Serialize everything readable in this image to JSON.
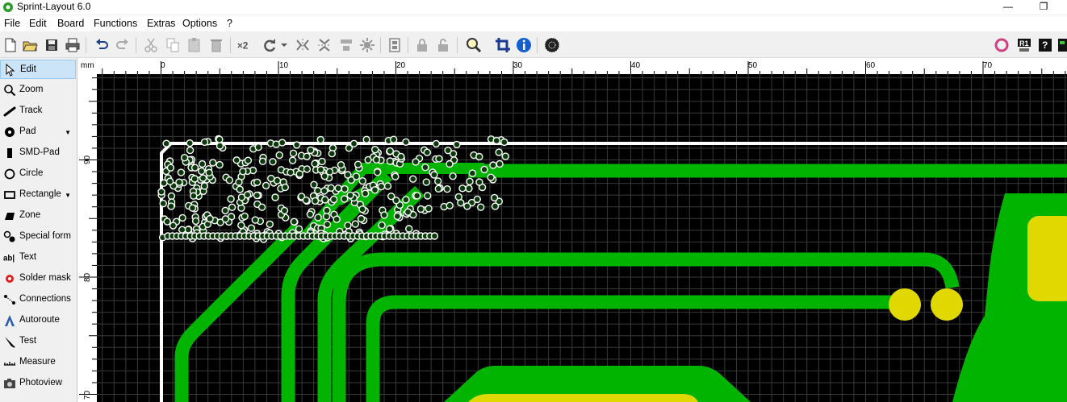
{
  "app": {
    "title": "Sprint-Layout 6.0"
  },
  "window_controls": {
    "minimize": "—",
    "restore": "❐"
  },
  "menu": [
    "File",
    "Edit",
    "Board",
    "Functions",
    "Extras",
    "Options",
    "?"
  ],
  "toolbar": {
    "left": [
      {
        "name": "new-icon"
      },
      {
        "name": "open-icon"
      },
      {
        "name": "save-icon"
      },
      {
        "name": "print-icon"
      },
      {
        "name": "undo-icon"
      },
      {
        "name": "redo-icon"
      },
      {
        "name": "cut-icon"
      },
      {
        "name": "copy-icon"
      },
      {
        "name": "paste-icon"
      },
      {
        "name": "delete-icon"
      },
      {
        "name": "duplicate-icon",
        "label": "×2"
      },
      {
        "name": "rotate-icon"
      },
      {
        "name": "mirror-horizontal-icon"
      },
      {
        "name": "mirror-vertical-icon"
      },
      {
        "name": "align-icon"
      },
      {
        "name": "snap-icon"
      },
      {
        "name": "group-icon"
      },
      {
        "name": "ungroup-icon"
      },
      {
        "name": "lock-icon"
      },
      {
        "name": "unlock-icon"
      },
      {
        "name": "zoom-icon"
      },
      {
        "name": "crop-icon"
      },
      {
        "name": "info-icon"
      },
      {
        "name": "gerber-icon"
      }
    ],
    "right": [
      {
        "name": "ring-icon"
      },
      {
        "name": "r1-icon",
        "label": "R1"
      },
      {
        "name": "help-chip-icon",
        "label": "?"
      },
      {
        "name": "chip-icon"
      }
    ]
  },
  "tools": [
    {
      "label": "Edit",
      "icon": "cursor-icon",
      "active": true
    },
    {
      "label": "Zoom",
      "icon": "magnifier-icon"
    },
    {
      "label": "Track",
      "icon": "track-icon"
    },
    {
      "label": "Pad",
      "icon": "pad-icon",
      "has_menu": true
    },
    {
      "label": "SMD-Pad",
      "icon": "smd-pad-icon"
    },
    {
      "label": "Circle",
      "icon": "circle-icon"
    },
    {
      "label": "Rectangle",
      "icon": "rectangle-icon",
      "has_menu": true
    },
    {
      "label": "Zone",
      "icon": "zone-icon"
    },
    {
      "label": "Special form",
      "icon": "special-form-icon"
    },
    {
      "label": "Text",
      "icon": "text-icon"
    },
    {
      "label": "Solder mask",
      "icon": "solder-mask-icon"
    },
    {
      "label": "Connections",
      "icon": "connections-icon"
    },
    {
      "label": "Autoroute",
      "icon": "autoroute-icon"
    },
    {
      "label": "Test",
      "icon": "test-icon"
    },
    {
      "label": "Measure",
      "icon": "measure-icon"
    },
    {
      "label": "Photoview",
      "icon": "photoview-icon"
    }
  ],
  "ruler": {
    "unit": "mm",
    "h_labels": [
      "0",
      "10",
      "20",
      "30",
      "40",
      "50",
      "60",
      "70"
    ],
    "v_labels": [
      "90",
      "80",
      "70"
    ]
  },
  "colors": {
    "copper": "#00b400",
    "pad_yellow": "#e0d800",
    "outline": "#ffffff",
    "grid": "#3a3a3a"
  }
}
